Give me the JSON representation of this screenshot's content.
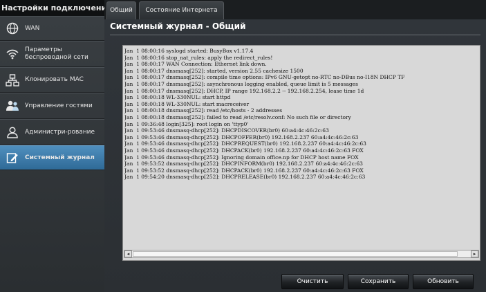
{
  "sidebar": {
    "header": "Настройки подключения",
    "items": [
      {
        "label": "WAN",
        "icon": "globe-icon"
      },
      {
        "label": "Параметры беспроводной сети",
        "icon": "wifi-icon"
      },
      {
        "label": "Клонировать MAC",
        "icon": "network-icon"
      },
      {
        "label": "Управление гостями",
        "icon": "guests-icon"
      },
      {
        "label": "Администри-рование",
        "icon": "admin-user-icon"
      },
      {
        "label": "Системный журнал",
        "icon": "log-edit-icon"
      }
    ],
    "active_index": 5
  },
  "tabs": [
    {
      "label": "Общий",
      "active": true
    },
    {
      "label": "Состояние Интернета",
      "active": false
    }
  ],
  "main": {
    "title": "Системный журнал - Общий",
    "log_lines": [
      "Jan  1 08:00:16 syslogd started: BusyBox v1.17.4",
      "Jan  1 08:00:16 stop_nat_rules: apply the redirect_rules!",
      "Jan  1 08:00:17 WAN Connection: Ethernet link down.",
      "Jan  1 08:00:17 dnsmasq[252]: started, version 2.55 cachesize 1500",
      "Jan  1 08:00:17 dnsmasq[252]: compile time options: IPv6 GNU-getopt no-RTC no-DBus no-I18N DHCP TF",
      "Jan  1 08:00:17 dnsmasq[252]: asynchronous logging enabled, queue limit is 5 messages",
      "Jan  1 08:00:17 dnsmasq[252]: DHCP, IP range 192.168.2.2 -- 192.168.2.254, lease time 1d",
      "Jan  1 08:00:18 WL-330NUL: start httpd",
      "Jan  1 08:00:18 WL-330NUL: start macreceiver",
      "Jan  1 08:00:18 dnsmasq[252]: read /etc/hosts - 2 addresses",
      "Jan  1 08:00:18 dnsmasq[252]: failed to read /etc/resolv.conf: No such file or directory",
      "Jan  1 09:36:48 login[325]: root login on 'ttyp0'",
      "Jan  1 09:53:46 dnsmasq-dhcp[252]: DHCPDISCOVER(br0) 60:a4:4c:46:2c:63",
      "Jan  1 09:53:46 dnsmasq-dhcp[252]: DHCPOFFER(br0) 192.168.2.237 60:a4:4c:46:2c:63",
      "Jan  1 09:53:46 dnsmasq-dhcp[252]: DHCPREQUEST(br0) 192.168.2.237 60:a4:4c:46:2c:63",
      "Jan  1 09:53:46 dnsmasq-dhcp[252]: DHCPACK(br0) 192.168.2.237 60:a4:4c:46:2c:63 FOX",
      "Jan  1 09:53:46 dnsmasq-dhcp[252]: Ignoring domain office.np for DHCP host name FOX",
      "Jan  1 09:53:52 dnsmasq-dhcp[252]: DHCPINFORM(br0) 192.168.2.237 60:a4:4c:46:2c:63",
      "Jan  1 09:53:52 dnsmasq-dhcp[252]: DHCPACK(br0) 192.168.2.237 60:a4:4c:46:2c:63 FOX",
      "Jan  1 09:54:20 dnsmasq-dhcp[252]: DHCPRELEASE(br0) 192.168.2.237 60:a4:4c:46:2c:63"
    ]
  },
  "buttons": {
    "clear": "Очистить",
    "save": "Сохранить",
    "refresh": "Обновить"
  },
  "colors": {
    "active_item": "#3c7aa8",
    "background": "#2b2f33",
    "log_background": "#d8d8d8"
  }
}
